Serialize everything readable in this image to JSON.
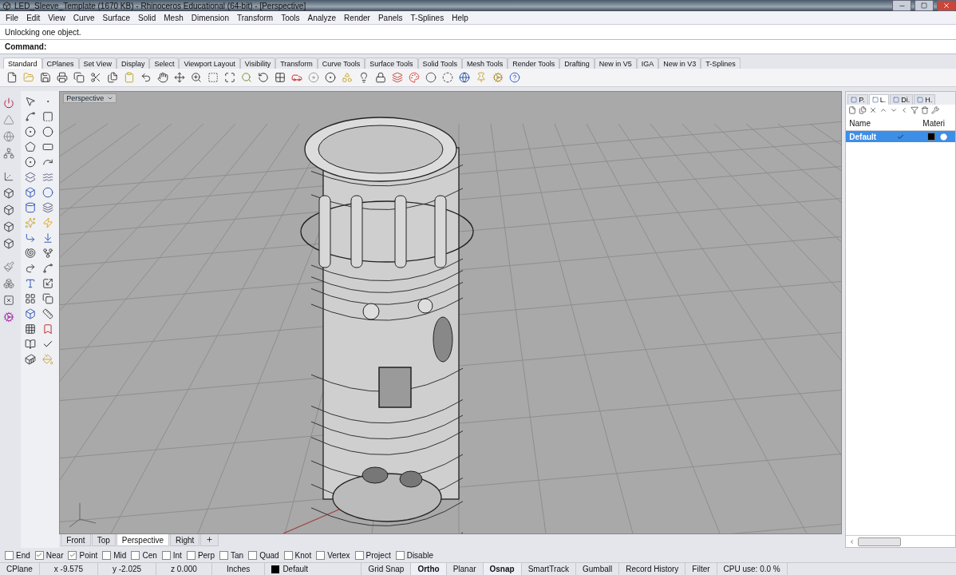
{
  "window": {
    "title": "LED_Sleeve_Template (1670 KB) - Rhinoceros Educational (64-bit) - [Perspective]"
  },
  "menu": [
    "File",
    "Edit",
    "View",
    "Curve",
    "Surface",
    "Solid",
    "Mesh",
    "Dimension",
    "Transform",
    "Tools",
    "Analyze",
    "Render",
    "Panels",
    "T-Splines",
    "Help"
  ],
  "command_history": "Unlocking one object.",
  "command_prompt": "Command:",
  "toolbar_tabs": [
    {
      "label": "Standard",
      "selected": true
    },
    {
      "label": "CPlanes",
      "selected": false
    },
    {
      "label": "Set View",
      "selected": false
    },
    {
      "label": "Display",
      "selected": false
    },
    {
      "label": "Select",
      "selected": false
    },
    {
      "label": "Viewport Layout",
      "selected": false
    },
    {
      "label": "Visibility",
      "selected": false
    },
    {
      "label": "Transform",
      "selected": false
    },
    {
      "label": "Curve Tools",
      "selected": false
    },
    {
      "label": "Surface Tools",
      "selected": false
    },
    {
      "label": "Solid Tools",
      "selected": false
    },
    {
      "label": "Mesh Tools",
      "selected": false
    },
    {
      "label": "Render Tools",
      "selected": false
    },
    {
      "label": "Drafting",
      "selected": false
    },
    {
      "label": "New in V5",
      "selected": false
    },
    {
      "label": "IGA",
      "selected": false
    },
    {
      "label": "New in V3",
      "selected": false
    },
    {
      "label": "T-Splines",
      "selected": false
    }
  ],
  "viewport": {
    "title": "Perspective"
  },
  "panel": {
    "tabs": [
      {
        "label": "P.",
        "selected": false
      },
      {
        "label": "L.",
        "selected": true
      },
      {
        "label": "Di.",
        "selected": false
      },
      {
        "label": "H.",
        "selected": false
      }
    ],
    "columns": [
      "Name",
      "Materi"
    ],
    "layers": [
      {
        "name": "Default",
        "current": true,
        "selected": true,
        "color": "#000000"
      }
    ]
  },
  "viewport_tabs": [
    {
      "label": "Front",
      "selected": false
    },
    {
      "label": "Top",
      "selected": false
    },
    {
      "label": "Perspective",
      "selected": true
    },
    {
      "label": "Right",
      "selected": false
    }
  ],
  "osnaps": [
    {
      "label": "End",
      "checked": false
    },
    {
      "label": "Near",
      "checked": true
    },
    {
      "label": "Point",
      "checked": true
    },
    {
      "label": "Mid",
      "checked": false
    },
    {
      "label": "Cen",
      "checked": false
    },
    {
      "label": "Int",
      "checked": false
    },
    {
      "label": "Perp",
      "checked": false
    },
    {
      "label": "Tan",
      "checked": false
    },
    {
      "label": "Quad",
      "checked": false
    },
    {
      "label": "Knot",
      "checked": false
    },
    {
      "label": "Vertex",
      "checked": false
    },
    {
      "label": "Project",
      "checked": false
    },
    {
      "label": "Disable",
      "checked": false
    }
  ],
  "status_bar": {
    "cplane": "CPlane",
    "x": "x -9.575",
    "y": "y -2.025",
    "z": "z 0.000",
    "units": "Inches",
    "layer": {
      "name": "Default",
      "color": "#000000"
    },
    "toggles": [
      {
        "label": "Grid Snap",
        "on": false
      },
      {
        "label": "Ortho",
        "on": true
      },
      {
        "label": "Planar",
        "on": false
      },
      {
        "label": "Osnap",
        "on": true
      },
      {
        "label": "SmartTrack",
        "on": false
      },
      {
        "label": "Gumball",
        "on": false
      },
      {
        "label": "Record History",
        "on": false
      },
      {
        "label": "Filter",
        "on": false
      }
    ],
    "cpu": "CPU use: 0.0 %"
  }
}
